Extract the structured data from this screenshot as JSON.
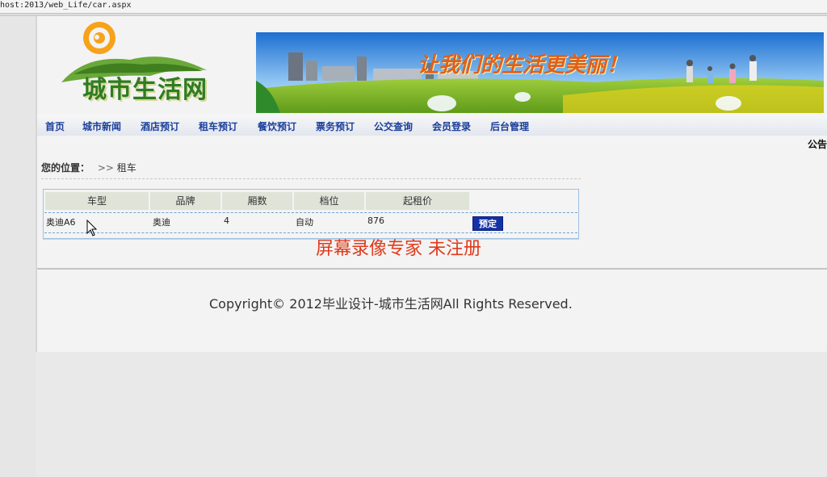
{
  "browser": {
    "url": "host:2013/web_Life/car.aspx"
  },
  "header": {
    "logo_text": "城市生活网",
    "slogan": "让我们的生活更美丽！"
  },
  "nav": {
    "items": [
      "首页",
      "城市新闻",
      "酒店预订",
      "租车预订",
      "餐饮预订",
      "票务预订",
      "公交查询",
      "会员登录",
      "后台管理"
    ]
  },
  "notice": {
    "label": "公告"
  },
  "breadcrumb": {
    "label": "您的位置：",
    "separator": ">>",
    "current": "租车"
  },
  "table": {
    "headers": [
      "车型",
      "品牌",
      "厢数",
      "档位",
      "起租价"
    ],
    "rows": [
      {
        "model": "奥迪A6",
        "brand": "奥迪",
        "doors": "4",
        "gear": "自动",
        "price": "876",
        "action": "预定"
      }
    ]
  },
  "watermark": {
    "text": "屏幕录像专家  未注册"
  },
  "footer": {
    "copyright": "Copyright© 2012毕业设计-城市生活网All Rights Reserved."
  },
  "colors": {
    "nav_text": "#1a3e9a",
    "button_bg": "#1431a8",
    "watermark": "#e03a1c",
    "logo_green": "#2f7d21",
    "slogan_orange": "#e25f17"
  }
}
